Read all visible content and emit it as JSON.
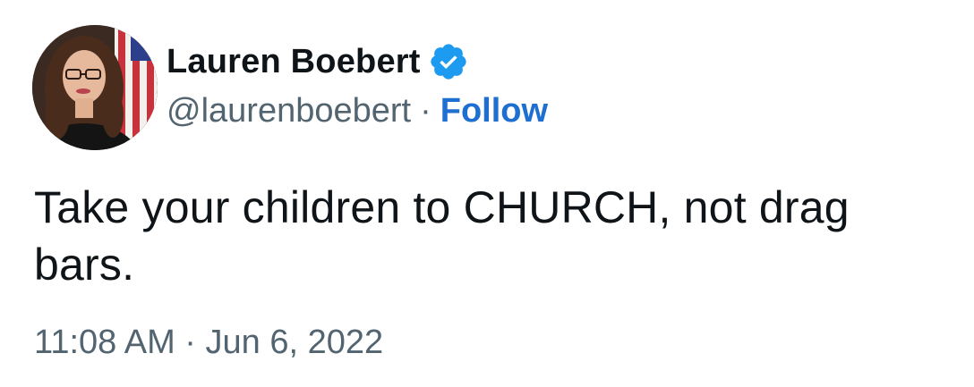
{
  "author": {
    "display_name": "Lauren Boebert",
    "handle": "@laurenboebert",
    "verified": true,
    "verified_icon": "verified-badge-icon"
  },
  "follow_label": "Follow",
  "separator": "·",
  "tweet": {
    "text": "Take your children to CHURCH, not drag bars.",
    "timestamp": "11:08 AM · Jun 6, 2022"
  },
  "colors": {
    "link": "#1d6fd1",
    "verified": "#1d9bf0",
    "secondary_text": "#536471",
    "primary_text": "#0f1419"
  }
}
